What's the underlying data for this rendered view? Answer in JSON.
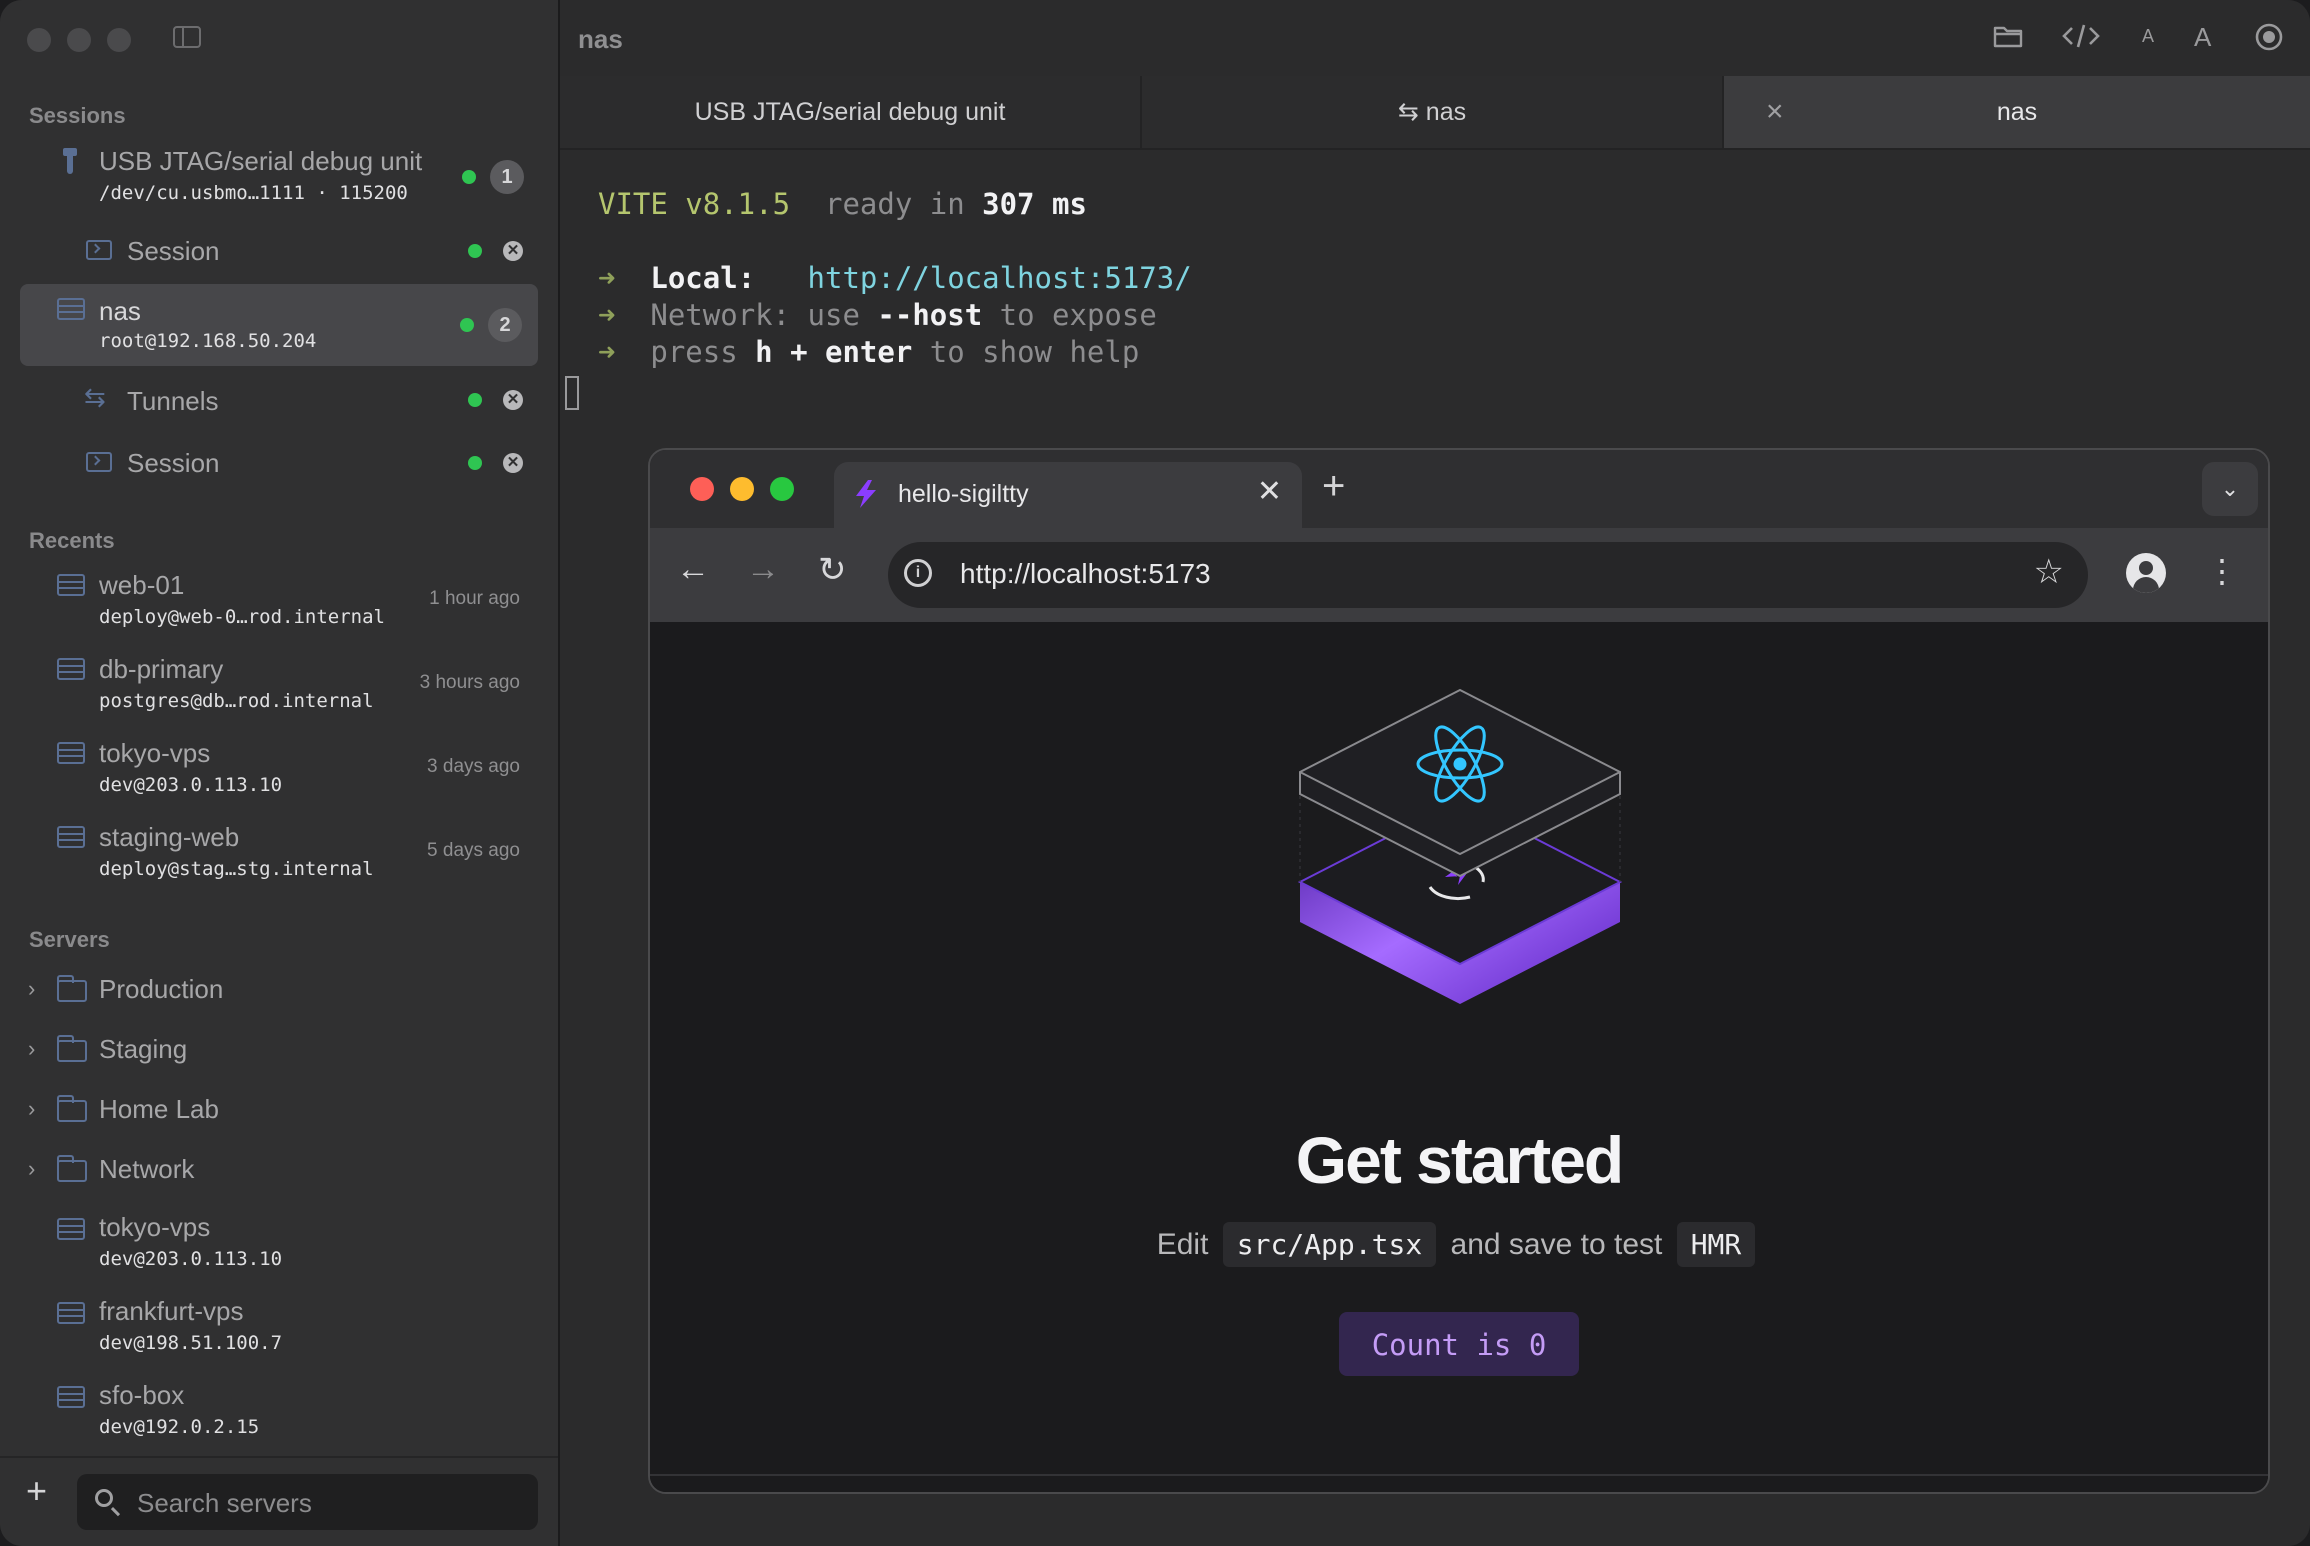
{
  "app": {
    "main_title": "nas"
  },
  "sidebar": {
    "sessions_label": "Sessions",
    "sessions": [
      {
        "name": "USB JTAG/serial debug unit",
        "sub": "/dev/cu.usbmo…1111 · 115200",
        "count": "1"
      },
      {
        "name": "Session"
      },
      {
        "name": "nas",
        "sub": "root@192.168.50.204",
        "count": "2"
      },
      {
        "name": "Tunnels"
      },
      {
        "name": "Session"
      }
    ],
    "recents_label": "Recents",
    "recents": [
      {
        "name": "web-01",
        "sub": "deploy@web-0…rod.internal",
        "ago": "1 hour ago"
      },
      {
        "name": "db-primary",
        "sub": "postgres@db…rod.internal",
        "ago": "3 hours ago"
      },
      {
        "name": "tokyo-vps",
        "sub": "dev@203.0.113.10",
        "ago": "3 days ago"
      },
      {
        "name": "staging-web",
        "sub": "deploy@stag…stg.internal",
        "ago": "5 days ago"
      }
    ],
    "servers_label": "Servers",
    "folders": [
      "Production",
      "Staging",
      "Home Lab",
      "Network"
    ],
    "servers": [
      {
        "name": "tokyo-vps",
        "sub": "dev@203.0.113.10"
      },
      {
        "name": "frankfurt-vps",
        "sub": "dev@198.51.100.7"
      },
      {
        "name": "sfo-box",
        "sub": "dev@192.0.2.15"
      }
    ],
    "search_placeholder": "Search servers"
  },
  "tabs": [
    {
      "label": "USB JTAG/serial debug unit"
    },
    {
      "label": "⇆ nas"
    },
    {
      "label": "nas"
    }
  ],
  "terminal": {
    "vite": "VITE v8.1.5",
    "ready": "ready in",
    "ready_ms": "307",
    "ms": "ms",
    "arrow": "➜",
    "local_label": "Local:",
    "local_url": "http://localhost:5173/",
    "network_label": "Network:",
    "network_use": "use",
    "network_flag": "--host",
    "network_rest": "to expose",
    "press": "press",
    "press_key": "h + enter",
    "press_rest": "to show help"
  },
  "browser": {
    "tab_title": "hello-sigiltty",
    "url": "http://localhost:5173",
    "headline": "Get started",
    "edit_prefix": "Edit",
    "edit_file": "src/App.tsx",
    "edit_mid": "and save to test",
    "edit_hmr": "HMR",
    "count_button": "Count is 0"
  },
  "colors": {
    "accent_purple": "#8b3dff",
    "react_cyan": "#33c6ff",
    "status_green": "#2fc552"
  },
  "icons": [
    "sidebar-toggle-icon",
    "usb-icon",
    "terminal-icon",
    "server-icon",
    "tunnel-icon",
    "folder-icon",
    "chevron-right-icon",
    "plus-icon",
    "search-icon",
    "folder-open-icon",
    "code-icon",
    "font-smaller-icon",
    "font-larger-icon",
    "record-icon",
    "close-icon",
    "back-icon",
    "forward-icon",
    "reload-icon",
    "info-icon",
    "star-icon",
    "profile-icon",
    "kebab-icon",
    "vite-icon",
    "react-icon"
  ]
}
